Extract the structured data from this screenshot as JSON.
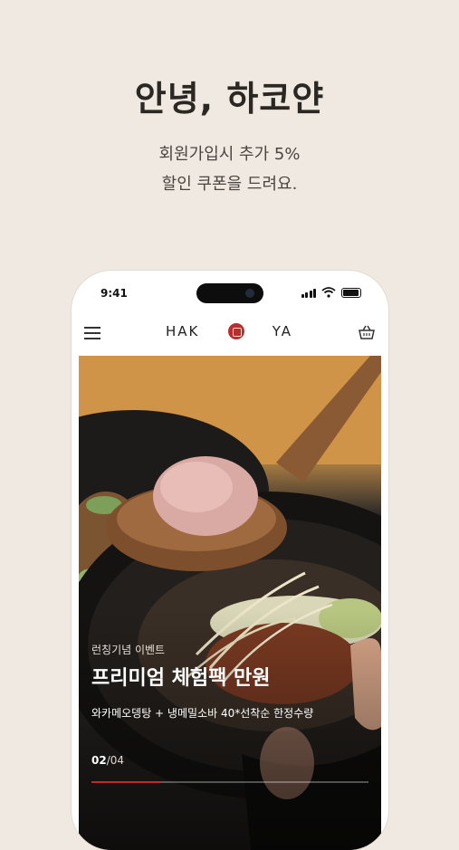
{
  "promo": {
    "headline": "안녕, 하코얀",
    "line1": "회원가입시 추가 5%",
    "line2": "할인 쿠폰을 드려요."
  },
  "status_bar": {
    "time": "9:41"
  },
  "header": {
    "logo_left": "HAK",
    "logo_right": "YA",
    "menu_icon": "hamburger-menu-icon",
    "cart_icon": "shopping-basket-icon"
  },
  "banner": {
    "tag": "런칭기념 이벤트",
    "title": "프리미엄 체험팩 만원",
    "description": "와카메오뎅탕 + 냉메밀소바 40*선착순 한정수량",
    "current": "02",
    "total": "/04",
    "progress": 0.25
  },
  "colors": {
    "background": "#efe9e1",
    "accent": "#c12a2a"
  }
}
